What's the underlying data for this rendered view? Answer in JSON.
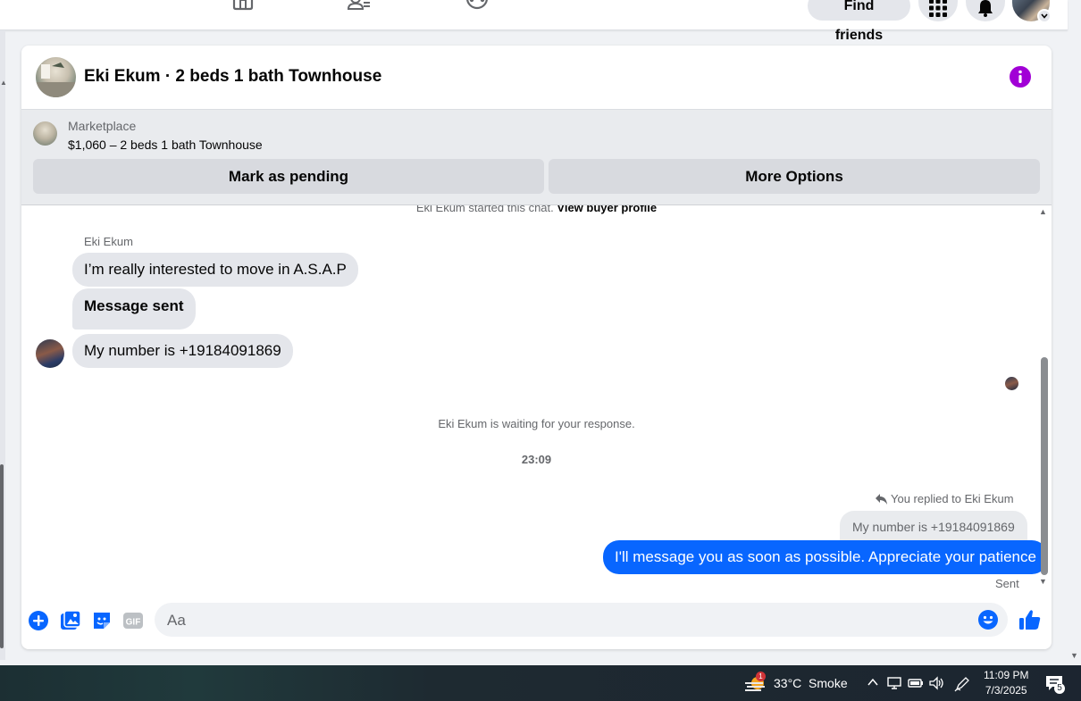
{
  "topbar": {
    "find_friends_label": "Find friends"
  },
  "chat": {
    "title": "Eki Ekum · 2 beds 1 bath Townhouse",
    "listing": {
      "source": "Marketplace",
      "title": "$1,060 – 2 beds 1 bath Townhouse",
      "mark_pending_label": "Mark as pending",
      "more_options_label": "More Options"
    },
    "started_text": "Eki Ekum started this chat.",
    "view_profile_label": "View buyer profile",
    "sender_name": "Eki Ekum",
    "incoming": [
      "I’m really interested to move in A.S.A.P",
      "Message sent",
      "My number is +19184091869"
    ],
    "waiting_text": "Eki Ekum is waiting for your response.",
    "timestamp": "23:09",
    "reply_label": "You replied to Eki Ekum",
    "quoted_message": "My number is +19184091869",
    "outgoing": "I'll message you as soon as possible. Appreciate your patience",
    "status": "Sent",
    "composer_placeholder": "Aa"
  },
  "taskbar": {
    "weather": "33°C  Smoke",
    "weather_badge": "1",
    "time": "11:09 PM",
    "date": "7/3/2025",
    "notification_count": "5"
  },
  "colors": {
    "accent": "#0866ff",
    "info": "#a100d6",
    "bubble_in": "#e4e6eb"
  }
}
